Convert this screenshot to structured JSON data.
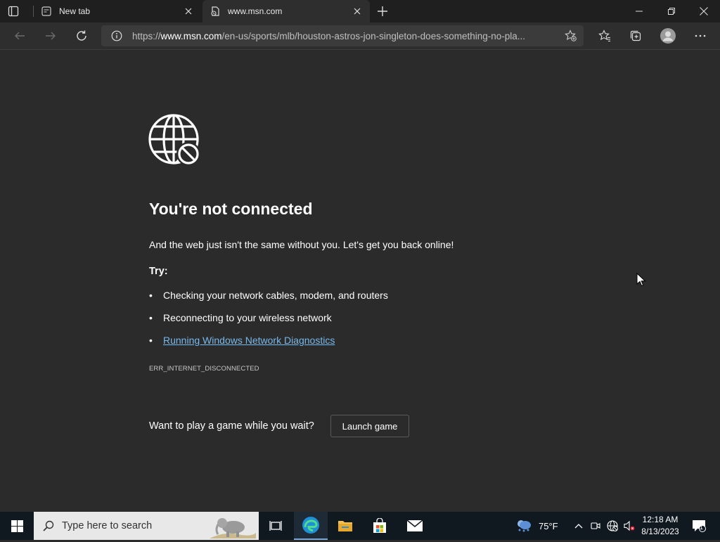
{
  "browser": {
    "tabs": [
      {
        "title": "New tab",
        "icon": "new-tab-page-icon",
        "active": false
      },
      {
        "title": "www.msn.com",
        "icon": "page-error-icon",
        "active": true
      }
    ],
    "address_bar": {
      "url_prefix": "https://",
      "url_domain": "www.msn.com",
      "url_path": "/en-us/sports/mlb/houston-astros-jon-singleton-does-something-no-pla..."
    }
  },
  "error_page": {
    "title": "You're not connected",
    "subtitle": "And the web just isn't the same without you. Let's get you back online!",
    "try_label": "Try:",
    "suggestions": [
      "Checking your network cables, modem, and routers",
      "Reconnecting to your wireless network",
      "Running Windows Network Diagnostics"
    ],
    "error_code": "ERR_INTERNET_DISCONNECTED",
    "game_prompt": "Want to play a game while you wait?",
    "launch_label": "Launch game",
    "link_color": "#76b9ed"
  },
  "taskbar": {
    "search_placeholder": "Type here to search",
    "weather": "75°F",
    "time": "12:18 AM",
    "date": "8/13/2023",
    "notification_count": "1"
  }
}
